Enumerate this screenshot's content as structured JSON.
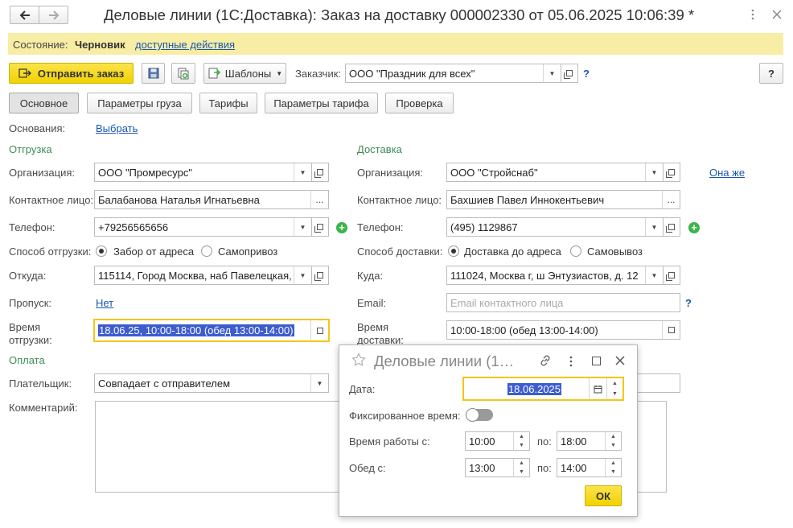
{
  "titlebar": {
    "title": "Деловые линии (1С:Доставка): Заказ на доставку 000002330 от 05.06.2025 10:06:39 *",
    "back_icon": "arrow-left-icon",
    "forward_icon": "arrow-right-icon",
    "more_icon": "more-vertical-icon",
    "close_icon": "close-icon"
  },
  "state_bar": {
    "label": "Состояние:",
    "value": "Черновик",
    "actions_link": "доступные действия"
  },
  "toolbar": {
    "send_label": "Отправить заказ",
    "templates_label": "Шаблоны",
    "customer_label": "Заказчик:",
    "customer_value": "ООО \"Праздник для всех\"",
    "help_mark": "?",
    "help_button": "?"
  },
  "tabs": [
    "Основное",
    "Параметры груза",
    "Тарифы",
    "Параметры тарифа",
    "Проверка"
  ],
  "basis": {
    "label": "Основания:",
    "link": "Выбрать"
  },
  "shipment": {
    "section": "Отгрузка",
    "org_label": "Организация:",
    "org_value": "ООО \"Промресурс\"",
    "contact_label": "Контактное лицо:",
    "contact_value": "Балабанова Наталья Игнатьевна",
    "phone_label": "Телефон:",
    "phone_value": "+79256565656",
    "method_label": "Способ отгрузки:",
    "method_option1": "Забор от адреса",
    "method_option2": "Самопривоз",
    "from_label": "Откуда:",
    "from_value": "115114, Город Москва, наб Павелецкая,",
    "pass_label": "Пропуск:",
    "pass_value": "Нет",
    "time_label_1": "Время",
    "time_label_2": "отгрузки:",
    "time_value": "18.06.25, 10:00-18:00 (обед 13:00-14:00)"
  },
  "delivery": {
    "section": "Доставка",
    "org_label": "Организация:",
    "org_value": "ООО \"Стройснаб\"",
    "same_link": "Она же",
    "contact_label": "Контактное лицо:",
    "contact_value": "Бахшиев Павел Иннокентьевич",
    "phone_label": "Телефон:",
    "phone_value": "(495) 1129867",
    "method_label": "Способ доставки:",
    "method_option1": "Доставка до адреса",
    "method_option2": "Самовывоз",
    "to_label": "Куда:",
    "to_value": "111024, Москва г, ш Энтузиастов, д. 12",
    "email_label": "Email:",
    "email_placeholder": "Email контактного лица",
    "email_help": "?",
    "time_label_1": "Время",
    "time_label_2": "доставки:",
    "time_value": "10:00-18:00 (обед 13:00-14:00)"
  },
  "payment": {
    "section": "Оплата",
    "payer_label": "Плательщик:",
    "payer_value": "Совпадает с отправителем",
    "comment_label": "Комментарий:"
  },
  "popup": {
    "title": "Деловые линии (1…",
    "date_label": "Дата:",
    "date_value": "18.06.2025",
    "fixed_label": "Фиксированное время:",
    "fixed_on": false,
    "work_label": "Время работы с:",
    "work_from": "10:00",
    "to_label": "по:",
    "work_to": "18:00",
    "lunch_label": "Обед с:",
    "lunch_from": "13:00",
    "lunch_to": "14:00",
    "ok_label": "ОК"
  },
  "colors": {
    "accent_yellow": "#f5d800",
    "state_bar_bg": "#f7eda4",
    "group_green": "#3e8c57",
    "link_blue": "#1a56b0",
    "selection_blue": "#3c5ccf"
  }
}
